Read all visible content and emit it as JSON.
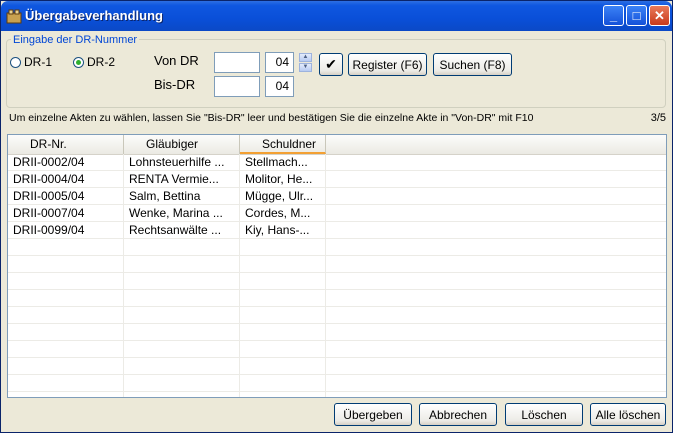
{
  "window": {
    "title": "Übergabeverhandlung"
  },
  "titlebar_buttons": {
    "minimize": "_",
    "maximize": "□",
    "close": "✕"
  },
  "group": {
    "legend": "Eingabe der DR-Nummer",
    "radio1": "DR-1",
    "radio2": "DR-2",
    "selected": "DR-2"
  },
  "von": {
    "label": "Von DR",
    "value": "",
    "year": "04"
  },
  "bis": {
    "label": "Bis-DR",
    "value": "",
    "year": "04"
  },
  "buttons": {
    "confirm_icon": "✔",
    "register": "Register (F6)",
    "suchen": "Suchen (F8)",
    "uebergeben": "Übergeben",
    "abbrechen": "Abbrechen",
    "loeschen": "Löschen",
    "alle_loeschen": "Alle löschen"
  },
  "hint": "Um einzelne Akten zu wählen, lassen Sie \"Bis-DR\" leer und bestätigen Sie die einzelne Akte in \"Von-DR\" mit F10",
  "page_indicator": "3/5",
  "table": {
    "columns": [
      "DR-Nr.",
      "Gläubiger",
      "Schuldner"
    ],
    "rows": [
      [
        "DRII-0002/04",
        "Lohnsteuerhilfe ...",
        "Stellmach..."
      ],
      [
        "DRII-0004/04",
        "RENTA Vermie...",
        "Molitor, He..."
      ],
      [
        "DRII-0005/04",
        "Salm, Bettina",
        "Mügge, Ulr..."
      ],
      [
        "DRII-0007/04",
        "Wenke, Marina ...",
        "Cordes, M..."
      ],
      [
        "DRII-0099/04",
        "Rechtsanwälte ...",
        "Kiy, Hans-..."
      ]
    ]
  },
  "colors": {
    "titlebar": "#0a4fd8",
    "group_legend": "#0046d5",
    "sort_accent": "#f3a033"
  }
}
